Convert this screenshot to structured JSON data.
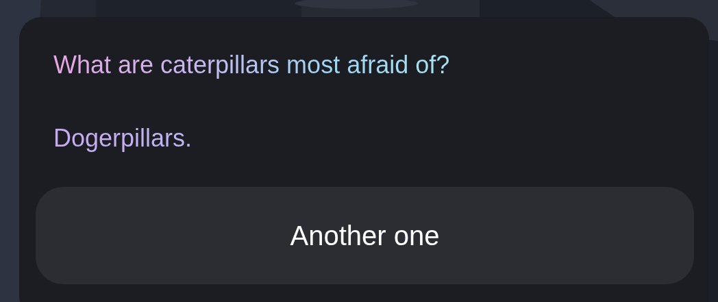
{
  "card": {
    "question": "What are caterpillars most afraid of?",
    "answer": "Dogerpillars.",
    "button": "Another one"
  }
}
